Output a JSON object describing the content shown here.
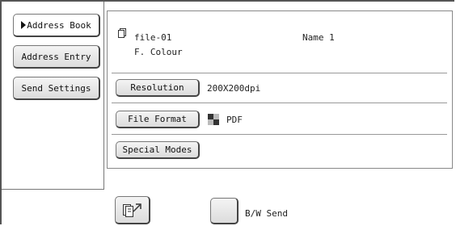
{
  "sidebar": {
    "address_book_label": "Address Book",
    "address_entry_label": "Address Entry",
    "send_settings_label": "Send Settings"
  },
  "file": {
    "name": "file-01",
    "mode": "F. Colour",
    "recipient": "Name 1"
  },
  "settings": {
    "resolution_label": "Resolution",
    "resolution_value": "200X200dpi",
    "file_format_label": "File Format",
    "file_format_value": "PDF",
    "special_modes_label": "Special Modes"
  },
  "bottom": {
    "bw_send_label": "B/W Send"
  },
  "colors": {
    "pdf_icon_dark": "#333333",
    "pdf_icon_light": "#bbbbbb"
  }
}
